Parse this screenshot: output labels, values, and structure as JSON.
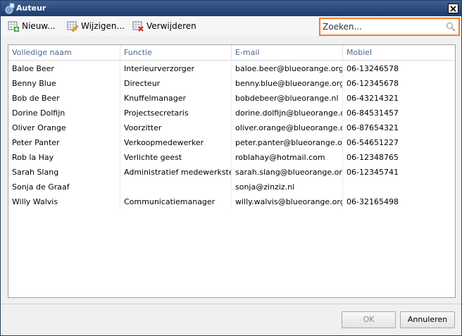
{
  "window": {
    "title": "Auteur"
  },
  "toolbar": {
    "new_label": "Nieuw...",
    "edit_label": "Wijzigen...",
    "delete_label": "Verwijderen"
  },
  "search": {
    "placeholder": "Zoeken..."
  },
  "table": {
    "columns": [
      "Volledige naam",
      "Functie",
      "E-mail",
      "Mobiel"
    ],
    "rows": [
      [
        "Baloe Beer",
        "Interieurverzorger",
        "baloe.beer@blueorange.org",
        "06-13246578"
      ],
      [
        "Benny Blue",
        "Directeur",
        "benny.blue@blueorange.org",
        "06-12345678"
      ],
      [
        "Bob de Beer",
        "Knuffelmanager",
        "bobdebeer@blueorange.nl",
        "06-43214321"
      ],
      [
        "Dorine Dolfijn",
        "Projectsecretaris",
        "dorine.dolfijn@blueorange.org",
        "06-84531457"
      ],
      [
        "Oliver Orange",
        "Voorzitter",
        "oliver.orange@blueorange.org",
        "06-87654321"
      ],
      [
        "Peter Panter",
        "Verkoopmedewerker",
        "peter.panter@blueorange.org",
        "06-54651227"
      ],
      [
        "Rob la Hay",
        "Verlichte geest",
        "roblahay@hotmail.com",
        "06-12348765"
      ],
      [
        "Sarah Slang",
        "Administratief medewerkster",
        "sarah.slang@blueorange.org",
        "06-12345741"
      ],
      [
        "Sonja de Graaf",
        "",
        "sonja@zinziz.nl",
        ""
      ],
      [
        "Willy Walvis",
        "Communicatiemanager",
        "willy.walvis@blueorange.org",
        "06-32165498"
      ]
    ]
  },
  "footer": {
    "ok_label": "OK",
    "cancel_label": "Annuleren"
  },
  "colors": {
    "title_bar": "#1e3c6e",
    "search_border": "#f08030",
    "header_text": "#4a6890"
  }
}
